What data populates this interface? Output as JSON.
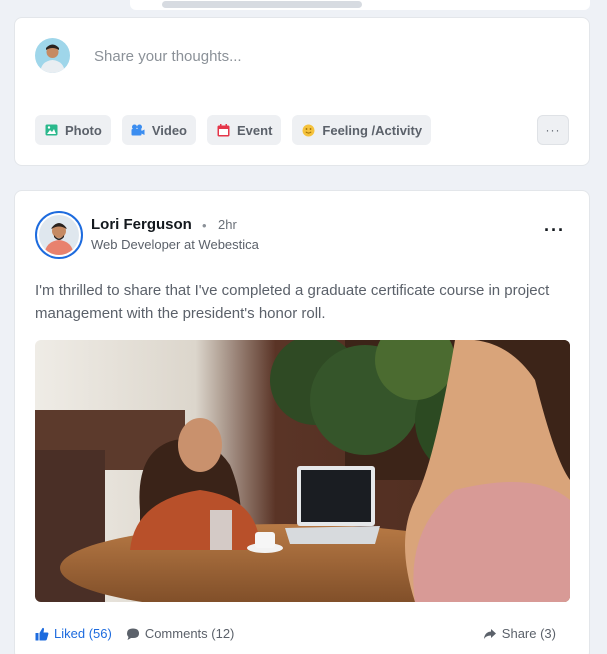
{
  "composer": {
    "placeholder": "Share your thoughts...",
    "actions": [
      {
        "label": "Photo",
        "icon": "photo-icon",
        "color": "#2ab88c"
      },
      {
        "label": "Video",
        "icon": "video-icon",
        "color": "#3b8df0"
      },
      {
        "label": "Event",
        "icon": "calendar-icon",
        "color": "#e5364a"
      },
      {
        "label": "Feeling /Activity",
        "icon": "smiley-icon",
        "color": "#f5c23c"
      }
    ],
    "more_label": "···"
  },
  "post": {
    "author": "Lori Ferguson",
    "separator": "•",
    "time": "2hr",
    "role": "Web Developer at Webestica",
    "menu_label": "···",
    "text": "I'm thrilled to share that I've completed a graduate certificate course in project management with the president's honor roll.",
    "footer": {
      "liked": "Liked (56)",
      "comments": "Comments (12)",
      "share": "Share (3)"
    }
  },
  "colors": {
    "accent": "#1d6bde",
    "background": "#eef1f6"
  }
}
